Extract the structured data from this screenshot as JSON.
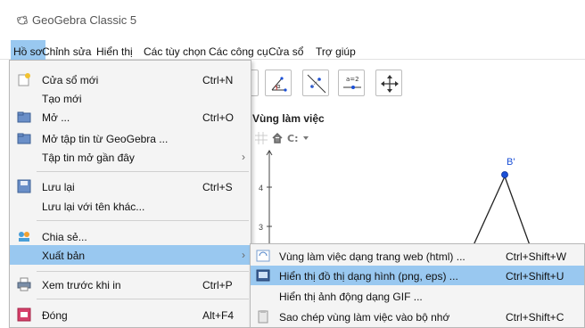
{
  "app": {
    "title": "GeoGebra Classic 5"
  },
  "menubar": {
    "items": [
      {
        "label": "Hồ sơ"
      },
      {
        "label": "Chỉnh sửa"
      },
      {
        "label": "Hiển thị"
      },
      {
        "label": "Các tùy chọn"
      },
      {
        "label": "Các công cụ"
      },
      {
        "label": "Cửa sổ"
      },
      {
        "label": "Trợ giúp"
      }
    ]
  },
  "graphics_view": {
    "title": "Vùng làm việc",
    "axis_ticks": [
      "4",
      "3"
    ],
    "point_label": "B'"
  },
  "file_menu": {
    "items": [
      {
        "label": "Cửa sổ mới",
        "shortcut": "Ctrl+N"
      },
      {
        "label": "Tạo mới",
        "shortcut": ""
      },
      {
        "label": "Mở ...",
        "shortcut": "Ctrl+O"
      },
      {
        "label": "Mở tập tin từ GeoGebra ...",
        "shortcut": ""
      },
      {
        "label": "Tập tin mở gần đây",
        "shortcut": ""
      },
      {
        "label": "Lưu lại",
        "shortcut": "Ctrl+S"
      },
      {
        "label": "Lưu lại với tên khác...",
        "shortcut": ""
      },
      {
        "label": "Chia sẻ...",
        "shortcut": ""
      },
      {
        "label": "Xuất bản",
        "shortcut": ""
      },
      {
        "label": "Xem trước khi in",
        "shortcut": "Ctrl+P"
      },
      {
        "label": "Đóng",
        "shortcut": "Alt+F4"
      }
    ]
  },
  "export_submenu": {
    "items": [
      {
        "label": "Vùng làm việc dạng trang web (html) ...",
        "shortcut": "Ctrl+Shift+W"
      },
      {
        "label": "Hiển thị đồ thị dạng hình (png, eps) ...",
        "shortcut": "Ctrl+Shift+U"
      },
      {
        "label": "Hiển thị ảnh động dạng GIF ...",
        "shortcut": ""
      },
      {
        "label": "Sao chép vùng làm việc vào bộ nhớ",
        "shortcut": "Ctrl+Shift+C"
      }
    ]
  },
  "colors": {
    "highlight": "#99c8f0",
    "point": "#1a4fd6",
    "menu_bg": "#f4f4f4"
  }
}
